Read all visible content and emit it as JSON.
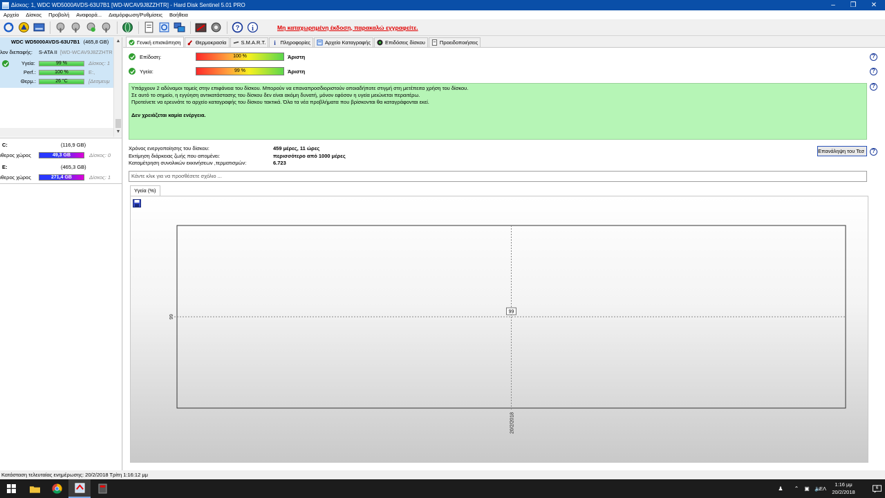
{
  "window": {
    "title": "Δίσκος: 1, WDC WD5000AVDS-63U7B1 [WD-WCAV9J8ZZHTR]  -  Hard Disk Sentinel 5.01 PRO"
  },
  "menu": [
    "Αρχείο",
    "Δίσκος",
    "Προβολή",
    "Αναφορά...",
    "Διαμόρφωση/Ρυθμίσεις",
    "Βοήθεια"
  ],
  "toolbar": {
    "unregistered_text": "Μη καταχωρημένη έκδοση, παρακαλώ εγγραφείτε."
  },
  "disk_card": {
    "name": "WDC WD5000AVDS-63U7B1",
    "size": "(465,8 GB)",
    "interface_label": "λον διεπαφής:",
    "interface_value": "S-ATA II",
    "serial": "[WD-WCAV9J8ZZHTR",
    "health_label": "Υγεία:",
    "health_value": "99 %",
    "health_pct": 99,
    "health_side": "Δίσκος: 1",
    "perf_label": "Perf.:",
    "perf_value": "100 %",
    "perf_pct": 100,
    "perf_side": "E:,",
    "temp_label": "Θερμ.:",
    "temp_value": "26 °C",
    "temp_side": "[Δεσμευμ"
  },
  "partitions": [
    {
      "letter": "C:",
      "size": "(116,9 GB)",
      "free_label": "ιθερος χώρος",
      "free_value": "49,3 GB",
      "disk": "Δίσκος: 0"
    },
    {
      "letter": "E:",
      "size": "(465,3 GB)",
      "free_label": "ιθερος χώρος",
      "free_value": "271,4 GB",
      "disk": "Δίσκος: 1"
    }
  ],
  "tabs": [
    {
      "label": "Γενική επισκόπηση",
      "active": true,
      "icon": "check-icon"
    },
    {
      "label": "Θερμοκρασία",
      "active": false,
      "icon": "thermometer-icon"
    },
    {
      "label": "S.M.A.R.T.",
      "active": false,
      "icon": "wrench-icon"
    },
    {
      "label": "Πληροφορίες",
      "active": false,
      "icon": "info-icon"
    },
    {
      "label": "Αρχείο Καταγραφής",
      "active": false,
      "icon": "log-icon"
    },
    {
      "label": "Επιδόσεις δίσκου",
      "active": false,
      "icon": "gauge-icon"
    },
    {
      "label": "Προειδοποιήσεις",
      "active": false,
      "icon": "warning-doc-icon"
    }
  ],
  "overview": {
    "performance": {
      "label": "Επίδοση:",
      "value": "100 %",
      "pct": 100,
      "rating": "Άριστη"
    },
    "health": {
      "label": "Υγεία:",
      "value": "99 %",
      "pct": 99,
      "rating": "Άριστη"
    },
    "message_lines": [
      "Υπάρχουν 2 αδύναμοι τομείς στην επιφάνεια του δίσκου. Μπορούν να επαναπροσδιοριστούν οποιαδήποτε στιγμή στη μετέπειτα χρήση του δίσκου.",
      "Σε αυτό το σημείο, η εγγύηση αντικατάστασης του δίσκου δεν είναι ακόμη δυνατή, μόνον εφόσον η υγεία μειώνεται περαιτέρω.",
      "Προτείνετε να ερευνάτε το αρχείο καταγραφής του δίσκου τακτικά. Όλα τα νέα προβλήματα που βρίσκονται θα καταγράφονται εκεί."
    ],
    "message_action": "Δεν χρειάζεται καμία ενέργεια.",
    "power_on_label": "Χρόνος ενεργοποίησης του δίσκου:",
    "power_on_value": "459 μέρες, 11 ώρες",
    "lifetime_label": "Εκτίμηση διάρκειας ζωής που απομένει:",
    "lifetime_value": "περισσότερο από 1000 μέρες",
    "startstop_label": "Καταμέτρηση συνολικών εκκινήσεων ,τερματισμών:",
    "startstop_value": "6.723",
    "repeat_button": "Επανάληψη του Τεσ",
    "comment_placeholder": "Κάντε κλικ για να προσθέσετε σχόλιο ..."
  },
  "chart_tab": "Υγεία (%)",
  "chart_data": {
    "type": "scatter",
    "title": "",
    "x": [
      "20/2/2018"
    ],
    "series": [
      {
        "values": [
          99
        ]
      }
    ],
    "ytick": "99",
    "xtick": "20/2/2018",
    "point_label": "99",
    "grid": "dotted crosshair"
  },
  "statusbar": {
    "text": "Κατάσταση τελευταίας ενημέρωσης: 20/2/2018 Τρίτη 1:16:12 μμ"
  },
  "taskbar": {
    "lang": "ΕΛ",
    "time": "1:16 μμ",
    "date": "20/2/2018",
    "notifications": "6"
  },
  "colors": {
    "titlebar": "#0a4fa8",
    "message_bg": "#b6f5b6",
    "unregistered": "#e00000"
  }
}
